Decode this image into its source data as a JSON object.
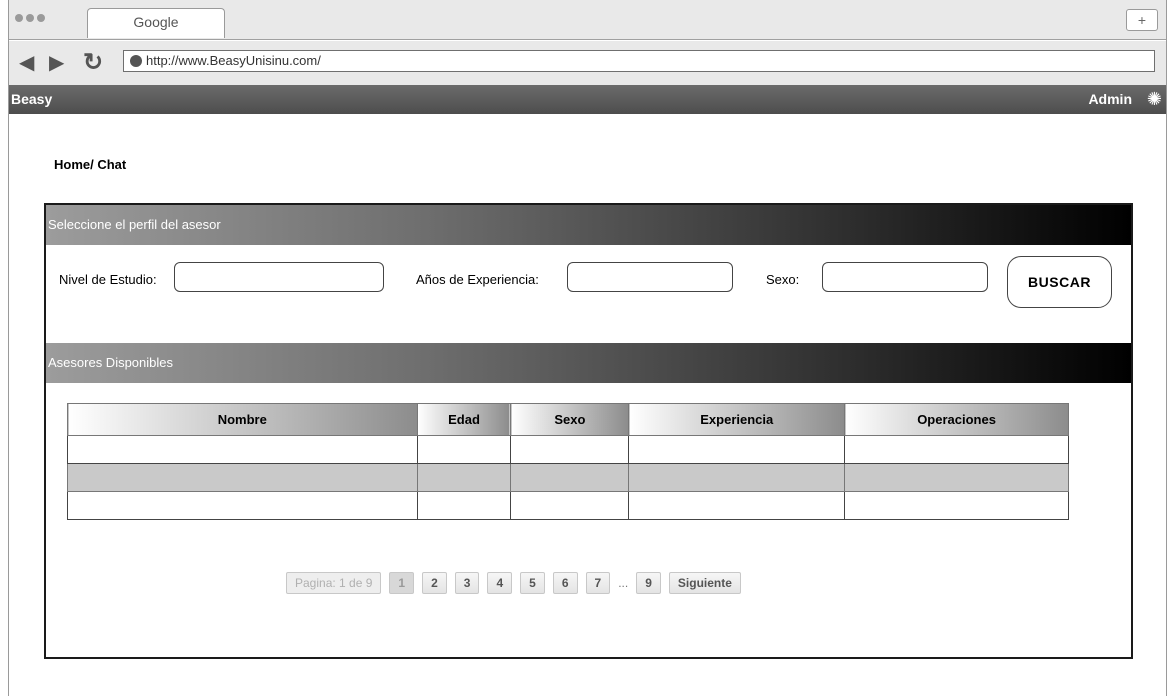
{
  "browser": {
    "tab_title": "Google",
    "new_tab": "+",
    "url": "http://www.BeasyUnisinu.com/"
  },
  "app": {
    "brand": "Beasy",
    "user": "Admin"
  },
  "breadcrumb": "Home/ Chat",
  "profile_section": {
    "title": "Seleccione el perfil del asesor",
    "fields": [
      {
        "label": "Nivel de Estudio:",
        "value": ""
      },
      {
        "label": "Años de Experiencia:",
        "value": ""
      },
      {
        "label": "Sexo:",
        "value": ""
      }
    ],
    "search_button": "BUSCAR"
  },
  "advisors_section": {
    "title": "Asesores Disponibles",
    "columns": [
      "Nombre",
      "Edad",
      "Sexo",
      "Experiencia",
      "Operaciones"
    ],
    "rows": [
      [
        "",
        "",
        "",
        "",
        ""
      ],
      [
        "",
        "",
        "",
        "",
        ""
      ],
      [
        "",
        "",
        "",
        "",
        ""
      ]
    ]
  },
  "pagination": {
    "info": "Pagina: 1 de 9",
    "pages": [
      "1",
      "2",
      "3",
      "4",
      "5",
      "6",
      "7"
    ],
    "ellipsis": "...",
    "last_page": "9",
    "next": "Siguiente"
  },
  "colors": {
    "app_bar": "#5a5a5a",
    "section_header_end": "#000000",
    "alt_row": "#c9c9c9"
  },
  "icons": {
    "back": "back-arrow-icon",
    "forward": "forward-arrow-icon",
    "reload": "reload-icon",
    "settings": "gear-icon"
  }
}
